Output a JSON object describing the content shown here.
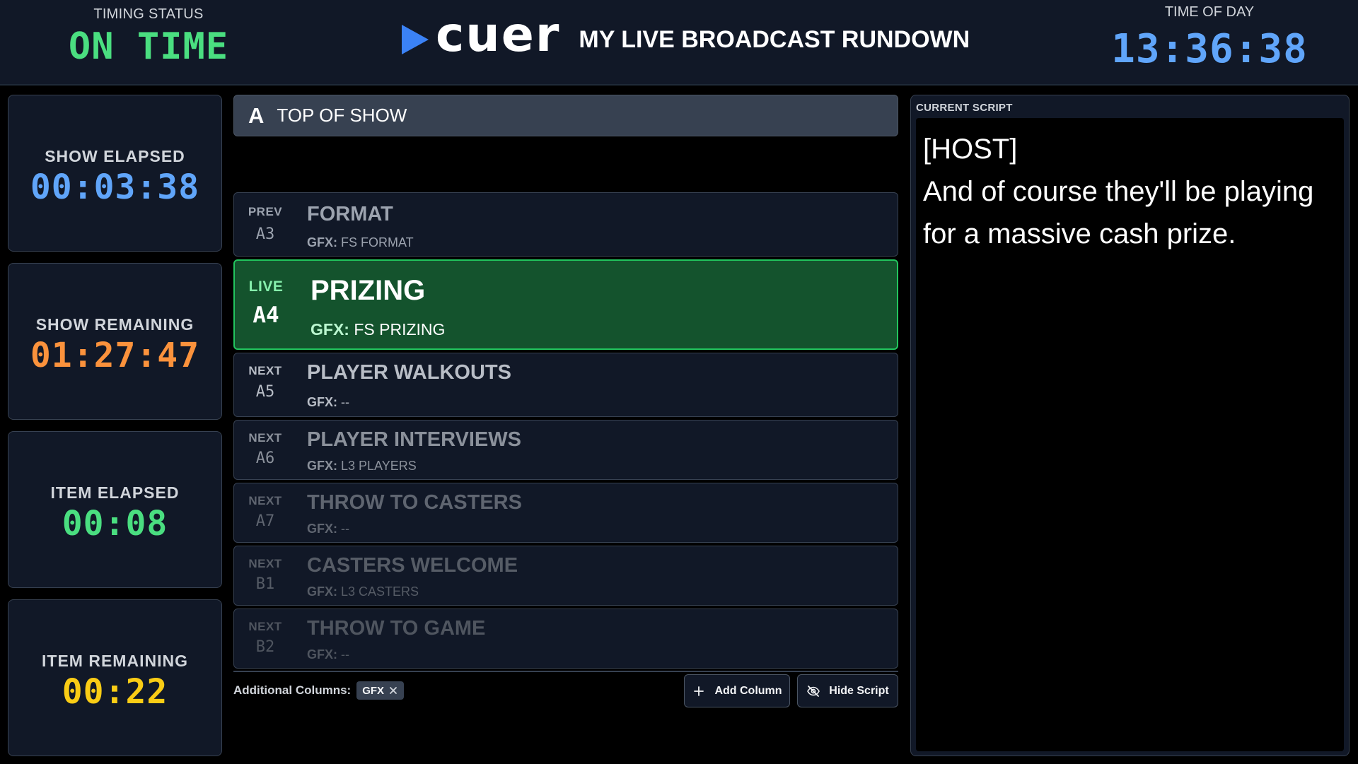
{
  "header": {
    "timing_status_label": "TIMING STATUS",
    "timing_status_value": "ON TIME",
    "logo_text": "cuer",
    "rundown_title": "MY LIVE BROADCAST RUNDOWN",
    "time_of_day_label": "TIME OF DAY",
    "time_of_day_value": "13:36:38"
  },
  "timers": {
    "show_elapsed": {
      "label": "SHOW ELAPSED",
      "value": "00:03:38",
      "color": "#60a5fa"
    },
    "show_remaining": {
      "label": "SHOW REMAINING",
      "value": "01:27:47",
      "color": "#fb923c"
    },
    "item_elapsed": {
      "label": "ITEM ELAPSED",
      "value": "00:08",
      "color": "#4ade80"
    },
    "item_remaining": {
      "label": "ITEM REMAINING",
      "value": "00:22",
      "color": "#facc15"
    }
  },
  "segment": {
    "letter": "A",
    "name": "TOP OF SHOW"
  },
  "rows": [
    {
      "status": "PREV",
      "number": "A3",
      "title": "FORMAT",
      "gfx_label": "GFX:",
      "gfx_value": "FS FORMAT"
    },
    {
      "status": "LIVE",
      "number": "A4",
      "title": "PRIZING",
      "gfx_label": "GFX:",
      "gfx_value": "FS PRIZING"
    },
    {
      "status": "NEXT",
      "number": "A5",
      "title": "PLAYER WALKOUTS",
      "gfx_label": "GFX:",
      "gfx_value": "--"
    },
    {
      "status": "NEXT",
      "number": "A6",
      "title": "PLAYER INTERVIEWS",
      "gfx_label": "GFX:",
      "gfx_value": "L3 PLAYERS"
    },
    {
      "status": "NEXT",
      "number": "A7",
      "title": "THROW TO CASTERS",
      "gfx_label": "GFX:",
      "gfx_value": "--"
    },
    {
      "status": "NEXT",
      "number": "B1",
      "title": "CASTERS WELCOME",
      "gfx_label": "GFX:",
      "gfx_value": "L3 CASTERS"
    },
    {
      "status": "NEXT",
      "number": "B2",
      "title": "THROW TO GAME",
      "gfx_label": "GFX:",
      "gfx_value": "--"
    }
  ],
  "footer": {
    "additional_columns_label": "Additional Columns:",
    "column_chips": [
      "GFX"
    ],
    "add_column_label": "Add Column",
    "hide_script_label": "Hide Script"
  },
  "script": {
    "label": "CURRENT SCRIPT",
    "lines": [
      "[HOST]",
      "And of course they'll be playing for a massive cash prize."
    ]
  },
  "colors": {
    "accent_blue": "#3b82f6",
    "live_bg": "#14532d",
    "live_border": "#22c55e",
    "on_time": "#4ade80"
  }
}
